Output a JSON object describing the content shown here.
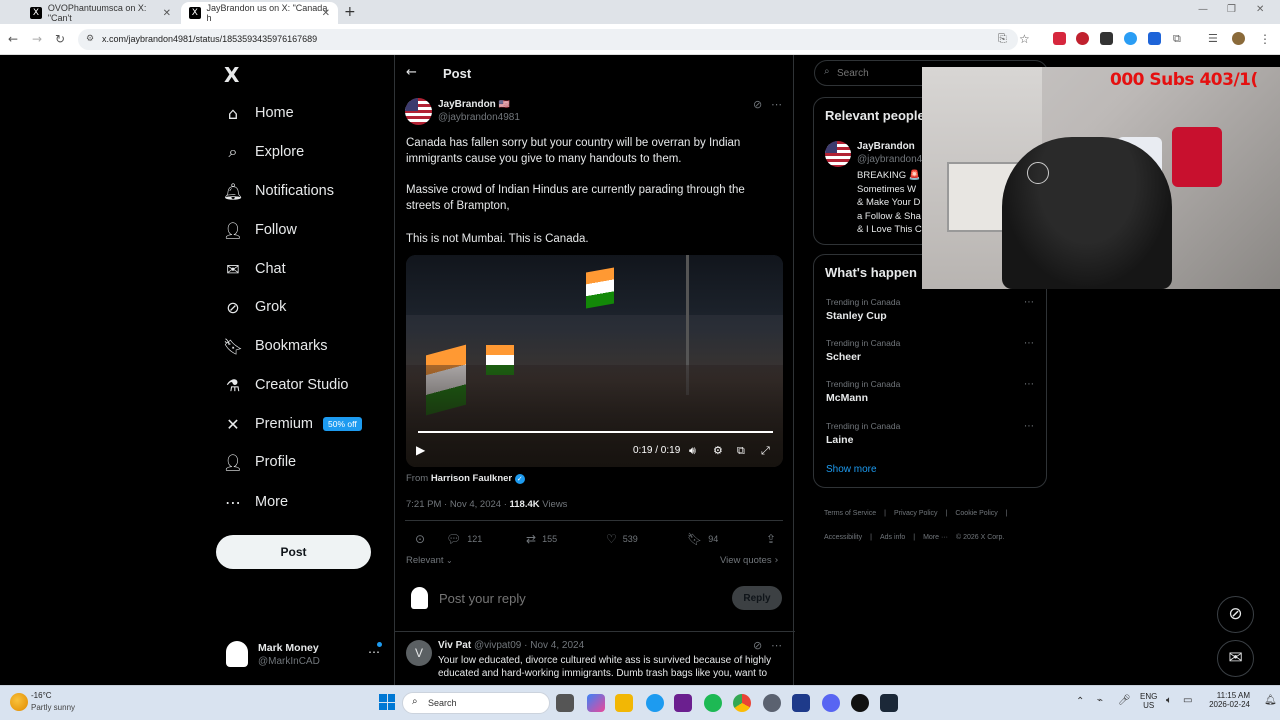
{
  "browser": {
    "tabs": [
      {
        "label": "OVOPhantuumsca on X: \"Can't",
        "favicon": "X"
      },
      {
        "label": "JayBrandon us on X: \"Canada h",
        "favicon": "X"
      }
    ],
    "new_tab_label": "+",
    "url": "x.com/jaybrandon4981/status/1853593435976167689"
  },
  "sidebar": {
    "logo": "X",
    "items": [
      {
        "label": "Home",
        "icon": "home-icon",
        "glyph": "⌂"
      },
      {
        "label": "Explore",
        "icon": "search-icon",
        "glyph": "⌕"
      },
      {
        "label": "Notifications",
        "icon": "bell-icon",
        "glyph": "🔔︎"
      },
      {
        "label": "Follow",
        "icon": "follow-icon",
        "glyph": "👤︎"
      },
      {
        "label": "Chat",
        "icon": "mail-icon",
        "glyph": "✉"
      },
      {
        "label": "Grok",
        "icon": "grok-icon",
        "glyph": "⊘"
      },
      {
        "label": "Bookmarks",
        "icon": "bookmark-icon",
        "glyph": "🔖︎"
      },
      {
        "label": "Creator Studio",
        "icon": "flask-icon",
        "glyph": "⚗"
      },
      {
        "label": "Premium",
        "icon": "x-icon",
        "glyph": "✕",
        "badge": "50% off"
      },
      {
        "label": "Profile",
        "icon": "profile-icon",
        "glyph": "👤︎"
      },
      {
        "label": "More",
        "icon": "more-circle-icon",
        "glyph": "⋯"
      }
    ],
    "post_button": "Post",
    "account": {
      "name": "Mark Money",
      "handle": "@MarkInCAD"
    }
  },
  "main": {
    "header_title": "Post",
    "tweet": {
      "author_name": "JayBrandon",
      "author_flag": "🇺🇸",
      "author_handle": "@jaybrandon4981",
      "text_p1": "Canada has fallen sorry but your country will be overran by Indian immigrants cause you give to many handouts to them.",
      "text_p2": "Massive crowd of Indian Hindus are currently parading through the streets of Brampton,",
      "text_p3": "This is not Mumbai. This is Canada.",
      "video_time": "0:19 / 0:19",
      "video_progress": 1.0,
      "from_label": "From",
      "from_name": "Harrison Faulkner",
      "timestamp": "7:21 PM · Nov 4, 2024 ·",
      "views_count": "118.4K",
      "views_label": "Views",
      "counts": {
        "replies": "121",
        "reposts": "155",
        "likes": "539",
        "bookmarks": "94"
      },
      "sort_label": "Relevant",
      "view_quotes": "View quotes",
      "reply_placeholder": "Post your reply",
      "reply_button": "Reply"
    },
    "reply": {
      "avatar_letter": "V",
      "name": "Viv Pat",
      "handle": "@vivpat09",
      "date": "· Nov 4, 2024",
      "text": "Your low educated, divorce cultured white ass is survived because of highly educated and hard-working immigrants. Dumb trash bags like you, want to"
    }
  },
  "right": {
    "search_placeholder": "Search",
    "relevant_title": "Relevant people",
    "relevant_name": "JayBrandon",
    "relevant_handle": "@jaybrandon4",
    "relevant_bio_lines": [
      "BREAKING 🚨",
      "Sometimes W",
      "& Make Your D",
      "a Follow & Sha",
      "& I Love This C"
    ],
    "whats_happening_title": "What's happen",
    "trends": [
      {
        "category": "Trending in Canada",
        "name": "Stanley Cup"
      },
      {
        "category": "Trending in Canada",
        "name": "Scheer"
      },
      {
        "category": "Trending in Canada",
        "name": "McMann"
      },
      {
        "category": "Trending in Canada",
        "name": "Laine"
      }
    ],
    "show_more": "Show more",
    "footer_row1": [
      "Terms of Service",
      "|",
      "Privacy Policy",
      "|",
      "Cookie Policy",
      "|"
    ],
    "footer_row2": [
      "Accessibility",
      "|",
      "Ads info",
      "|",
      "More ···",
      "© 2026 X Corp."
    ]
  },
  "overlay": {
    "subs_text": "000 Subs 403/1("
  },
  "taskbar": {
    "weather_temp": "-16°C",
    "weather_desc": "Partly sunny",
    "search_label": "Search",
    "lang_top": "ENG",
    "lang_bottom": "US",
    "time": "11:15 AM",
    "date": "2026-02-24"
  },
  "colors": {
    "accent": "#1d9bf0",
    "background": "#000000",
    "border": "#2f3336",
    "muted": "#71767b"
  }
}
